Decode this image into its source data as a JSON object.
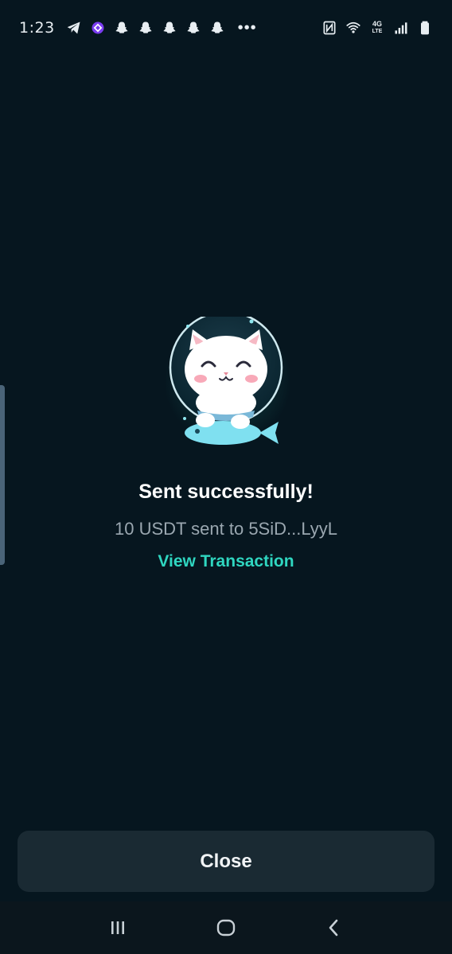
{
  "status_bar": {
    "time": "1:23",
    "overflow": "•••",
    "left_icons": [
      "telegram-icon",
      "app-icon",
      "snapchat-icon",
      "snapchat-icon",
      "snapchat-icon",
      "snapchat-icon",
      "snapchat-icon"
    ],
    "right_icons": [
      "nfc-icon",
      "wifi-icon",
      "lte-icon",
      "signal-icon",
      "battery-icon"
    ],
    "network_label": "4G",
    "network_sub": "LTE"
  },
  "result": {
    "title": "Sent successfully!",
    "summary": "10 USDT sent to 5SiD...LyyL",
    "view_link": "View Transaction"
  },
  "footer": {
    "close_label": "Close"
  },
  "nav": {
    "icons": [
      "recents-icon",
      "home-icon",
      "back-icon"
    ]
  },
  "colors": {
    "background": "#06161f",
    "accent": "#2fd6c0",
    "button_bg": "#1a2a33",
    "muted_text": "#9aa7b0"
  }
}
